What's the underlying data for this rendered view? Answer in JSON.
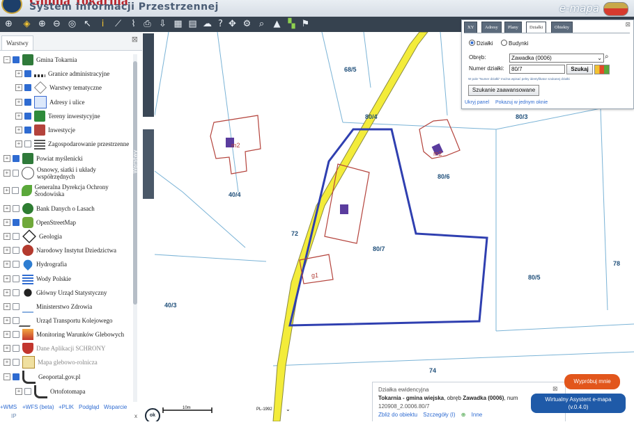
{
  "header": {
    "title": "Gmina Tokarnia",
    "subtitle": "System Informacji Przestrzennej",
    "brand": "e-mapa"
  },
  "toolbar": {
    "icons": [
      "globe-layers-icon",
      "layers-icon",
      "zoom-in-icon",
      "zoom-out-icon",
      "zoom-extent-icon",
      "pointer-icon",
      "info-icon",
      "measure-line-icon",
      "measure-area-icon",
      "print-icon",
      "download-icon",
      "grid-icon",
      "table-icon",
      "comment-icon",
      "help-icon",
      "pan-icon",
      "settings-icon",
      "search-icon",
      "triangle-icon",
      "color-icon",
      "share-icon"
    ]
  },
  "sidebar": {
    "tab_label": "Warstwy",
    "vertical_tab_label": "Warstwy",
    "layers": [
      {
        "label": "Gmina Tokarnia",
        "checked": true,
        "expanded": true,
        "indent": 0,
        "icon": "crest-icon"
      },
      {
        "label": "Granice administracyjne",
        "checked": true,
        "indent": 1,
        "icon": "border-line-icon"
      },
      {
        "label": "Warstwy tematyczne",
        "checked": true,
        "indent": 1,
        "icon": "stack-icon"
      },
      {
        "label": "Adresy i ulice",
        "checked": true,
        "indent": 1,
        "icon": "envelope-icon"
      },
      {
        "label": "Tereny inwestycyjne",
        "checked": true,
        "indent": 1,
        "icon": "dollar-icon"
      },
      {
        "label": "Inwestycje",
        "checked": true,
        "indent": 1,
        "icon": "building-icon"
      },
      {
        "label": "Zagospodarowanie przestrzenne",
        "checked": false,
        "indent": 1,
        "icon": "grid-plan-icon"
      },
      {
        "label": "Powiat myślenicki",
        "checked": true,
        "indent": 0,
        "icon": "crest-icon"
      },
      {
        "label": "Osnowy, siatki i układy współrzędnych",
        "checked": false,
        "indent": 0,
        "icon": "globe-icon"
      },
      {
        "label": "Generalna Dyrekcja Ochrony Środowiska",
        "checked": false,
        "indent": 0,
        "icon": "leaf-icon"
      },
      {
        "label": "Bank Danych o Lasach",
        "checked": false,
        "indent": 0,
        "icon": "tree-icon"
      },
      {
        "label": "OpenStreetMap",
        "checked": true,
        "indent": 0,
        "icon": "map-pin-icon"
      },
      {
        "label": "Geologia",
        "checked": false,
        "indent": 0,
        "icon": "hammer-icon"
      },
      {
        "label": "Narodowy Instytut Dziedzictwa",
        "checked": false,
        "indent": 0,
        "icon": "heritage-icon"
      },
      {
        "label": "Hydrografia",
        "checked": false,
        "indent": 0,
        "icon": "water-drop-icon"
      },
      {
        "label": "Wody Polskie",
        "checked": false,
        "indent": 0,
        "icon": "wave-icon"
      },
      {
        "label": "Główny Urząd Statystyczny",
        "checked": false,
        "indent": 0,
        "icon": "stats-icon"
      },
      {
        "label": "Ministerstwo Zdrowia",
        "checked": false,
        "indent": 0,
        "icon": "pulse-icon"
      },
      {
        "label": "Urząd Transportu Kolejowego",
        "checked": false,
        "indent": 0,
        "icon": "rail-icon"
      },
      {
        "label": "Monitoring Warunków Glebowych",
        "checked": false,
        "indent": 0,
        "icon": "soil-icon"
      },
      {
        "label": "Dane Aplikacji SCHRONY",
        "checked": false,
        "indent": 0,
        "icon": "shield-icon",
        "grey": true
      },
      {
        "label": "Mapa glebowo-rolnicza",
        "checked": false,
        "indent": 0,
        "icon": "g-icon",
        "grey": true
      },
      {
        "label": "Geoportal.gov.pl",
        "checked": true,
        "expanded": true,
        "indent": 0,
        "icon": "geoportal-icon"
      },
      {
        "label": "Ortofotomapa",
        "checked": false,
        "indent": 1,
        "icon": "geoportal-icon"
      }
    ],
    "bottom_links": [
      "+WMS",
      "+WFS (beta)",
      "+PLIK",
      "Podgląd",
      "Wsparcie"
    ],
    "bottom_small": [
      "IP",
      "x"
    ]
  },
  "search_panel": {
    "tabs": [
      "XY",
      "Adresy",
      "Plany",
      "Działki",
      "Obiekty"
    ],
    "active_tab": "Działki",
    "radio_options": [
      "Działki",
      "Budynki"
    ],
    "selected_radio": "Działki",
    "obreb_label": "Obręb:",
    "obreb_value": "Zawadka (0006)",
    "numer_label": "Numer działki:",
    "numer_value": "80/7",
    "search_button": "Szukaj",
    "hint": "W pole \"Numer działki\" można wpisać pełny identyfikator szukanej działki",
    "advanced_button": "Szukanie zaawansowane",
    "links": [
      "Ukryj panel",
      "Pokazuj w jednym oknie"
    ]
  },
  "map": {
    "labels": [
      "68/5",
      "80/4",
      "80/3",
      "80/6",
      "40/4",
      "72",
      "80/7",
      "80/5",
      "78",
      "40/3",
      "74",
      "g1",
      "m2",
      "m2"
    ],
    "scale_label": "10m",
    "crs_label": "PL-1992",
    "ok_label": "ok"
  },
  "info_popup": {
    "title": "Działka ewidencyjna",
    "line_bold_1": "Tokarnia - gmina wiejska",
    "line_mid": ", obręb ",
    "line_bold_2": "Zawadka (0006)",
    "line_tail": ", num",
    "identifier": "120908_2.0006.80/7",
    "links": [
      "Zbliż do obiektu",
      "Szczegóły (I)",
      "Inne"
    ]
  },
  "assistant": {
    "try_label": "Wypróbuj mnie",
    "label": "Wirtualny Asystent e-mapa",
    "version": "(v.0.4.0)"
  },
  "colors": {
    "parcel_highlight": "#2f3fb0",
    "road_fill": "#f3ec3a",
    "building_outline": "#b4433c",
    "parcel_lines": "#7ab3d6",
    "toolbar_bg": "#36424f"
  }
}
